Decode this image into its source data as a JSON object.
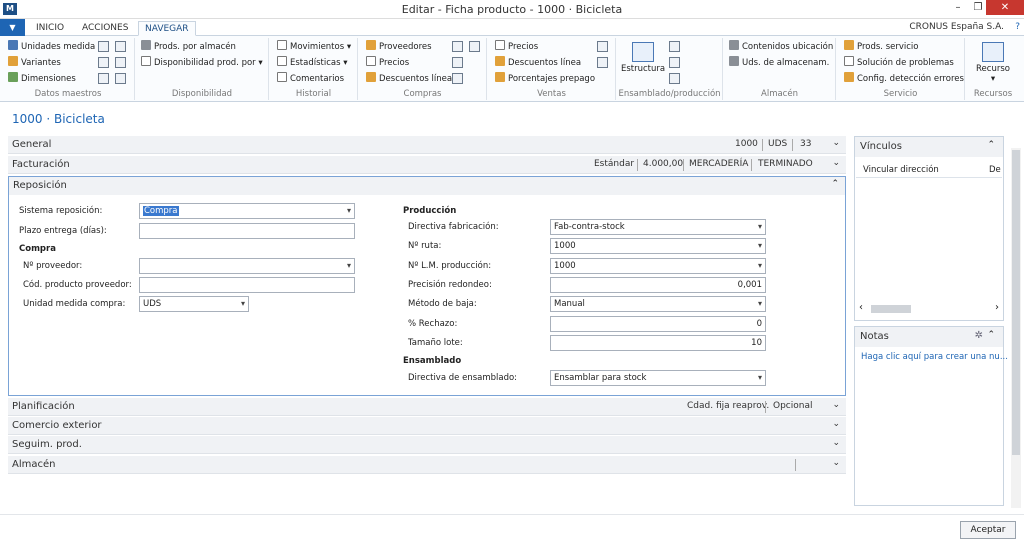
{
  "window": {
    "title": "Editar - Ficha producto - 1000 · Bicicleta",
    "logo": "M",
    "minimize_glyph": "–",
    "restore_glyph": "❐",
    "close_glyph": "✕"
  },
  "tabs": {
    "file_glyph": "▼",
    "items": [
      "INICIO",
      "ACCIONES",
      "NAVEGAR"
    ],
    "active": "NAVEGAR"
  },
  "company": "CRONUS España S.A.",
  "help_glyph": "?",
  "ribbon": {
    "groups": [
      {
        "label": "Datos maestros",
        "items": [
          "Unidades medida",
          "Variantes",
          "Dimensiones"
        ]
      },
      {
        "label": "Disponibilidad",
        "items": [
          "Prods. por almacén",
          "Disponibilidad prod. por"
        ]
      },
      {
        "label": "Historial",
        "items": [
          "Movimientos",
          "Estadísticas",
          "Comentarios"
        ]
      },
      {
        "label": "Compras",
        "items": [
          "Proveedores",
          "Precios",
          "Descuentos línea"
        ]
      },
      {
        "label": "Ventas",
        "items": [
          "Precios",
          "Descuentos línea",
          "Porcentajes prepago"
        ]
      },
      {
        "label": "Ensamblado/producción",
        "items": [
          "Estructura"
        ]
      },
      {
        "label": "Almacén",
        "items": [
          "Contenidos ubicación",
          "Uds. de almacenam."
        ]
      },
      {
        "label": "Servicio",
        "items": [
          "Prods. servicio",
          "Solución de problemas",
          "Config. detección errores"
        ]
      },
      {
        "label": "Recursos",
        "items": [
          "Recurso"
        ]
      }
    ]
  },
  "page_title": "1000 · Bicicleta",
  "fasttabs": {
    "general": {
      "name": "General",
      "info": [
        "1000",
        "UDS",
        "33"
      ]
    },
    "facturacion": {
      "name": "Facturación",
      "info": [
        "Estándar",
        "4.000,00",
        "MERCADERÍA",
        "TERMINADO"
      ]
    },
    "reposicion": {
      "name": "Reposición"
    },
    "planificacion": {
      "name": "Planificación",
      "info": [
        "Cdad. fija reaprov.",
        "Opcional"
      ]
    },
    "comercio": {
      "name": "Comercio exterior"
    },
    "seguim": {
      "name": "Seguim. prod."
    },
    "almacen": {
      "name": "Almacén"
    }
  },
  "reposicion": {
    "sistema_label": "Sistema reposición:",
    "sistema_value": "Compra",
    "plazo_label": "Plazo entrega (días):",
    "plazo_value": "",
    "compra_heading": "Compra",
    "proveedor_label": "Nº proveedor:",
    "proveedor_value": "",
    "cod_prod_label": "Cód. producto proveedor:",
    "cod_prod_value": "",
    "um_compra_label": "Unidad medida compra:",
    "um_compra_value": "UDS",
    "produccion_heading": "Producción",
    "directiva_fab_label": "Directiva fabricación:",
    "directiva_fab_value": "Fab-contra-stock",
    "ruta_label": "Nº ruta:",
    "ruta_value": "1000",
    "lm_label": "Nº L.M. producción:",
    "lm_value": "1000",
    "precision_label": "Precisión redondeo:",
    "precision_value": "0,001",
    "metodo_label": "Método de baja:",
    "metodo_value": "Manual",
    "rechazo_label": "% Rechazo:",
    "rechazo_value": "0",
    "lote_label": "Tamaño lote:",
    "lote_value": "10",
    "ensamblado_heading": "Ensamblado",
    "directiva_ens_label": "Directiva de ensamblado:",
    "directiva_ens_value": "Ensamblar para stock"
  },
  "vinculos": {
    "title": "Vínculos",
    "col1": "Vincular dirección",
    "col2": "De"
  },
  "notas": {
    "title": "Notas",
    "link": "Haga clic aquí para crear una nu..."
  },
  "footer": {
    "accept": "Aceptar"
  },
  "glyphs": {
    "chevron_down": "⌄",
    "chevron_up": "⌃",
    "dropdown": "▾",
    "scroll_left": "‹",
    "scroll_right": "›",
    "gear": "✲"
  }
}
